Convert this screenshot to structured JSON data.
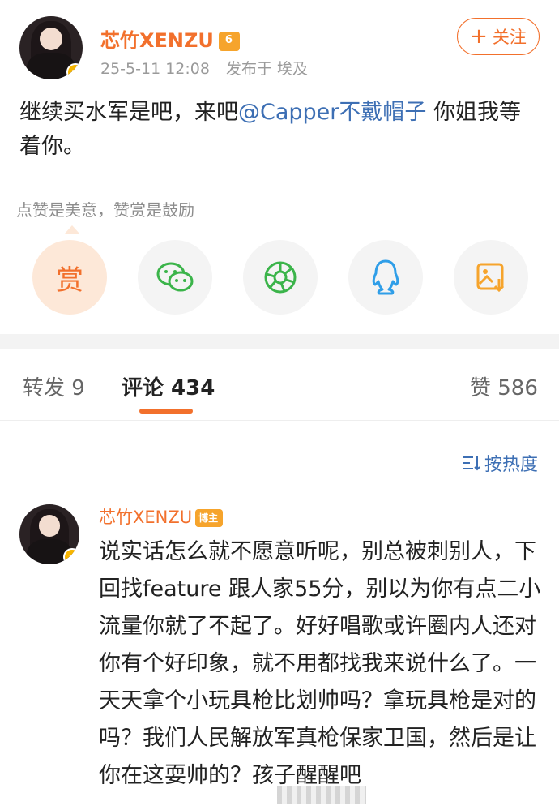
{
  "post": {
    "username": "芯竹XENZU",
    "date": "25-5-11 12:08",
    "location": "发布于 埃及",
    "follow_label": "关注",
    "text_before": "继续买水军是吧，来吧",
    "mention": "@Capper不戴帽子",
    "text_after": " 你姐我等着你。"
  },
  "reward": {
    "hint": "点赞是美意，赞赏是鼓励",
    "reward_label": "赏"
  },
  "share_icons": [
    "reward-icon",
    "wechat-icon",
    "moments-icon",
    "qq-icon",
    "save-image-icon"
  ],
  "tabs": {
    "repost": "转发 9",
    "comments": "评论 434",
    "likes": "赞 586"
  },
  "sort": {
    "label": "按热度"
  },
  "comment": {
    "username": "芯竹XENZU",
    "tag": "博主",
    "text": "说实话怎么就不愿意听呢，别总被刺别人，下回找feature 跟人家55分，别以为你有点二小流量你就了不起了。好好唱歌或许圈内人还对你有个好印象，就不用都找我来说什么了。一天天拿个小玩具枪比划帅吗？拿玩具枪是对的吗？我们人民解放军真枪保家卫国，然后是让你在这耍帅的？孩子醒醒吧"
  },
  "colors": {
    "accent": "#f2702c",
    "link": "#3d6fb4",
    "muted": "#9a9a9a"
  }
}
